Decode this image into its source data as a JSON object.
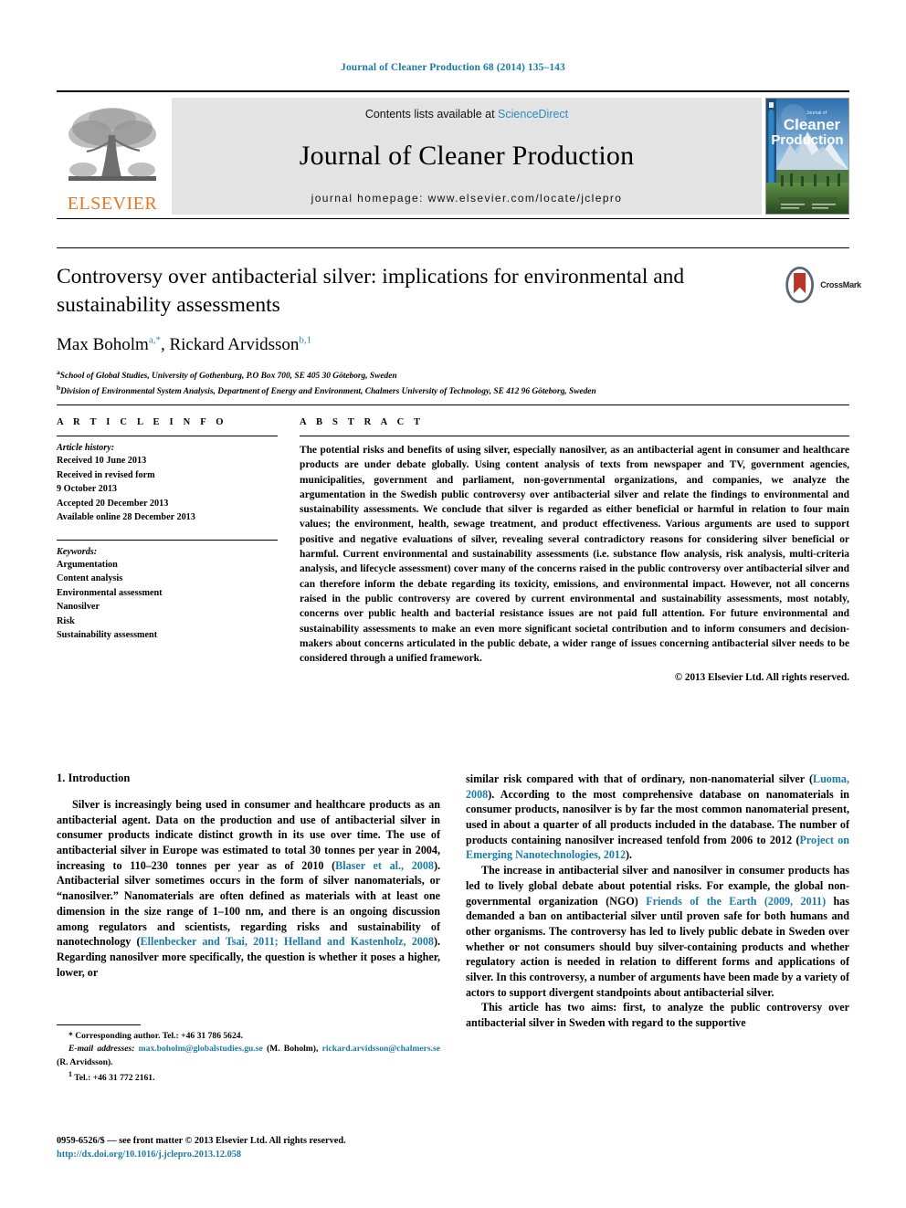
{
  "running_head": "Journal of Cleaner Production 68 (2014) 135–143",
  "masthead": {
    "publisher_name": "ELSEVIER",
    "contents_prefix": "Contents lists available at ",
    "contents_link": "ScienceDirect",
    "journal_title": "Journal of Cleaner Production",
    "homepage": "journal homepage: www.elsevier.com/locate/jclepro",
    "cover_title_small": "Journal of",
    "cover_title_line1": "Cleaner",
    "cover_title_line2": "Production"
  },
  "article": {
    "title": "Controversy over antibacterial silver: implications for environmental and sustainability assessments",
    "authors_html": "Max Boholm",
    "author1": "Max Boholm",
    "author1_sup": "a,*",
    "author2": "Rickard Arvidsson",
    "author2_sup": "b,1",
    "affiliation_a_sup": "a",
    "affiliation_a": "School of Global Studies, University of Gothenburg, P.O Box 700, SE 405 30 Göteborg, Sweden",
    "affiliation_b_sup": "b",
    "affiliation_b": "Division of Environmental System Analysis, Department of Energy and Environment, Chalmers University of Technology, SE 412 96 Göteborg, Sweden",
    "crossmark_label": "CrossMark"
  },
  "article_info": {
    "section_label": "A R T I C L E  I N F O",
    "history_heading": "Article history:",
    "history": [
      "Received 10 June 2013",
      "Received in revised form",
      "9 October 2013",
      "Accepted 20 December 2013",
      "Available online 28 December 2013"
    ],
    "keywords_heading": "Keywords:",
    "keywords": [
      "Argumentation",
      "Content analysis",
      "Environmental assessment",
      "Nanosilver",
      "Risk",
      "Sustainability assessment"
    ]
  },
  "abstract": {
    "section_label": "A B S T R A C T",
    "text": "The potential risks and benefits of using silver, especially nanosilver, as an antibacterial agent in consumer and healthcare products are under debate globally. Using content analysis of texts from newspaper and TV, government agencies, municipalities, government and parliament, non-governmental organizations, and companies, we analyze the argumentation in the Swedish public controversy over antibacterial silver and relate the findings to environmental and sustainability assessments. We conclude that silver is regarded as either beneficial or harmful in relation to four main values; the environment, health, sewage treatment, and product effectiveness. Various arguments are used to support positive and negative evaluations of silver, revealing several contradictory reasons for considering silver beneficial or harmful. Current environmental and sustainability assessments (i.e. substance flow analysis, risk analysis, multi-criteria analysis, and lifecycle assessment) cover many of the concerns raised in the public controversy over antibacterial silver and can therefore inform the debate regarding its toxicity, emissions, and environmental impact. However, not all concerns raised in the public controversy are covered by current environmental and sustainability assessments, most notably, concerns over public health and bacterial resistance issues are not paid full attention. For future environmental and sustainability assessments to make an even more significant societal contribution and to inform consumers and decision-makers about concerns articulated in the public debate, a wider range of issues concerning antibacterial silver needs to be considered through a unified framework.",
    "copyright": "© 2013 Elsevier Ltd. All rights reserved."
  },
  "body": {
    "section_number_title": "1.  Introduction",
    "left_para_1_a": "Silver is increasingly being used in consumer and healthcare products as an antibacterial agent. Data on the production and use of antibacterial silver in consumer products indicate distinct growth in its use over time. The use of antibacterial silver in Europe was estimated to total 30 tonnes per year in 2004, increasing to 110–230 tonnes per year as of 2010 (",
    "left_cite_1": "Blaser et al., 2008",
    "left_para_1_b": "). Antibacterial silver sometimes occurs in the form of silver nanomaterials, or “nanosilver.” Nanomaterials are often defined as materials with at least one dimension in the size range of 1–100 nm, and there is an ongoing discussion among regulators and scientists, regarding risks and sustainability of nanotechnology (",
    "left_cite_2": "Ellenbecker and Tsai, 2011; Helland and Kastenholz, 2008",
    "left_para_1_c": "). Regarding nanosilver more specifically, the question is whether it poses a higher, lower, or",
    "right_para_1_a": "similar risk compared with that of ordinary, non-nanomaterial silver (",
    "right_cite_1": "Luoma, 2008",
    "right_para_1_b": "). According to the most comprehensive database on nanomaterials in consumer products, nanosilver is by far the most common nanomaterial present, used in about a quarter of all products included in the database. The number of products containing nanosilver increased tenfold from 2006 to 2012 (",
    "right_cite_2": "Project on Emerging Nanotechnologies, 2012",
    "right_para_1_c": ").",
    "right_para_2_a": "The increase in antibacterial silver and nanosilver in consumer products has led to lively global debate about potential risks. For example, the global non-governmental organization (NGO) ",
    "right_cite_3": "Friends of the Earth (2009, 2011)",
    "right_para_2_b": " has demanded a ban on antibacterial silver until proven safe for both humans and other organisms. The controversy has led to lively public debate in Sweden over whether or not consumers should buy silver-containing products and whether regulatory action is needed in relation to different forms and applications of silver. In this controversy, a number of arguments have been made by a variety of actors to support divergent standpoints about antibacterial silver.",
    "right_para_3": "This article has two aims: first, to analyze the public controversy over antibacterial silver in Sweden with regard to the supportive"
  },
  "footnotes": {
    "corresponding": "* Corresponding author. Tel.: +46 31 786 5624.",
    "email_label": "E-mail addresses:",
    "email_1": "max.boholm@globalstudies.gu.se",
    "email_1_owner": "(M. Boholm),",
    "email_2": "rickard.arvidsson@chalmers.se",
    "email_2_owner": "(R. Arvidsson).",
    "tel_sup": "1",
    "tel": "Tel.: +46 31 772 2161."
  },
  "footer": {
    "issn_line": "0959-6526/$ — see front matter © 2013 Elsevier Ltd. All rights reserved.",
    "doi": "http://dx.doi.org/10.1016/j.jclepro.2013.12.058"
  },
  "colors": {
    "link": "#1b7ba8",
    "elsevier_orange": "#E87722",
    "masthead_bg": "#e3e3e3"
  }
}
